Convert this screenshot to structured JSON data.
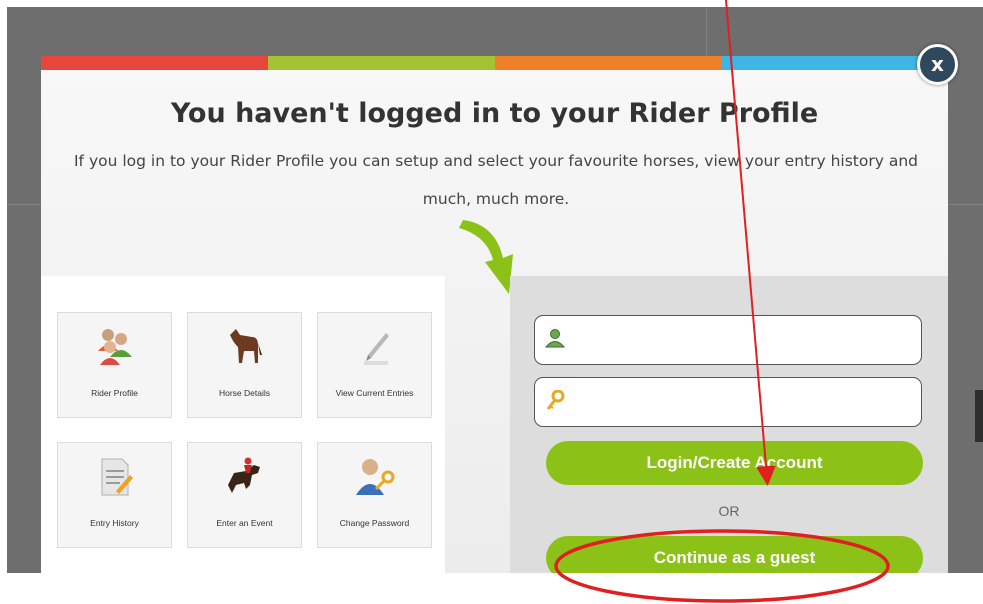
{
  "colors": {
    "stripe": [
      "#e8453c",
      "#a5c235",
      "#f07f2b",
      "#3fb4e5"
    ],
    "button": "#8cc218",
    "annotation": "#e02020",
    "close_button": "#30485e"
  },
  "modal": {
    "close_label": "x",
    "title": "You haven't logged in to your Rider Profile",
    "description": "If you log in to your Rider Profile you can setup and select your favourite horses, view your entry history and much, much more."
  },
  "tiles": [
    {
      "label": "Rider Profile",
      "icon": "rider-profile-icon"
    },
    {
      "label": "Horse Details",
      "icon": "horse-icon"
    },
    {
      "label": "View Current Entries",
      "icon": "pencil-paper-icon"
    },
    {
      "label": "Entry History",
      "icon": "document-icon"
    },
    {
      "label": "Enter an Event",
      "icon": "jumping-horse-icon"
    },
    {
      "label": "Change Password",
      "icon": "user-key-icon"
    }
  ],
  "login": {
    "username_value": "",
    "password_value": "",
    "username_icon": "user-icon",
    "password_icon": "key-icon",
    "login_button": "Login/Create Account",
    "or_label": "OR",
    "guest_button": "Continue as a guest"
  }
}
